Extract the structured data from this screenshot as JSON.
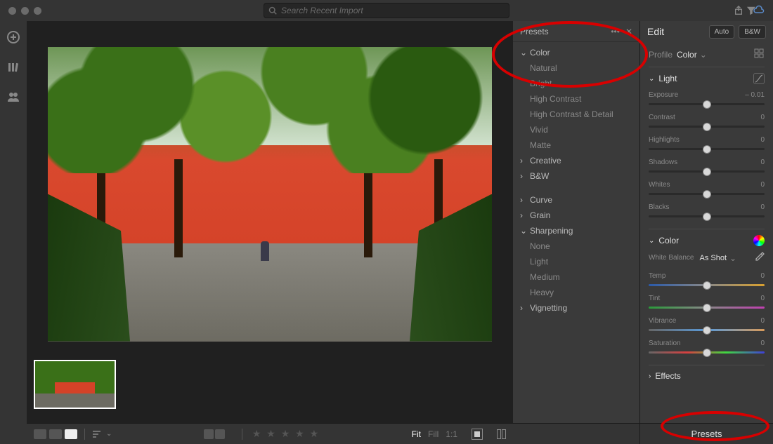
{
  "search": {
    "placeholder": "Search Recent Import"
  },
  "presets": {
    "title": "Presets",
    "groups": [
      {
        "name": "Color",
        "expanded": true,
        "items": [
          "Natural",
          "Bright",
          "High Contrast",
          "High Contrast & Detail",
          "Vivid",
          "Matte"
        ]
      },
      {
        "name": "Creative",
        "expanded": false,
        "items": []
      },
      {
        "name": "B&W",
        "expanded": false,
        "items": []
      },
      {
        "name": "Curve",
        "expanded": false,
        "items": []
      },
      {
        "name": "Grain",
        "expanded": false,
        "items": []
      },
      {
        "name": "Sharpening",
        "expanded": true,
        "items": [
          "None",
          "Light",
          "Medium",
          "Heavy"
        ]
      },
      {
        "name": "Vignetting",
        "expanded": false,
        "items": []
      }
    ]
  },
  "edit": {
    "title": "Edit",
    "auto": "Auto",
    "bw": "B&W",
    "profile_label": "Profile",
    "profile_value": "Color",
    "sections": {
      "light": {
        "title": "Light",
        "sliders": [
          {
            "name": "Exposure",
            "value": "– 0.01",
            "pos": 50
          },
          {
            "name": "Contrast",
            "value": "0",
            "pos": 50
          },
          {
            "name": "Highlights",
            "value": "0",
            "pos": 50
          },
          {
            "name": "Shadows",
            "value": "0",
            "pos": 50
          },
          {
            "name": "Whites",
            "value": "0",
            "pos": 50
          },
          {
            "name": "Blacks",
            "value": "0",
            "pos": 50
          }
        ]
      },
      "color": {
        "title": "Color",
        "wb_label": "White Balance",
        "wb_value": "As Shot",
        "sliders": [
          {
            "name": "Temp",
            "value": "0",
            "pos": 50,
            "track": "temp"
          },
          {
            "name": "Tint",
            "value": "0",
            "pos": 50,
            "track": "tint"
          },
          {
            "name": "Vibrance",
            "value": "0",
            "pos": 50,
            "track": "vib"
          },
          {
            "name": "Saturation",
            "value": "0",
            "pos": 50,
            "track": "sat"
          }
        ]
      },
      "effects": {
        "title": "Effects"
      }
    },
    "footer": "Presets"
  },
  "bottombar": {
    "zoom_fit": "Fit",
    "zoom_fill": "Fill",
    "zoom_11": "1:1"
  }
}
